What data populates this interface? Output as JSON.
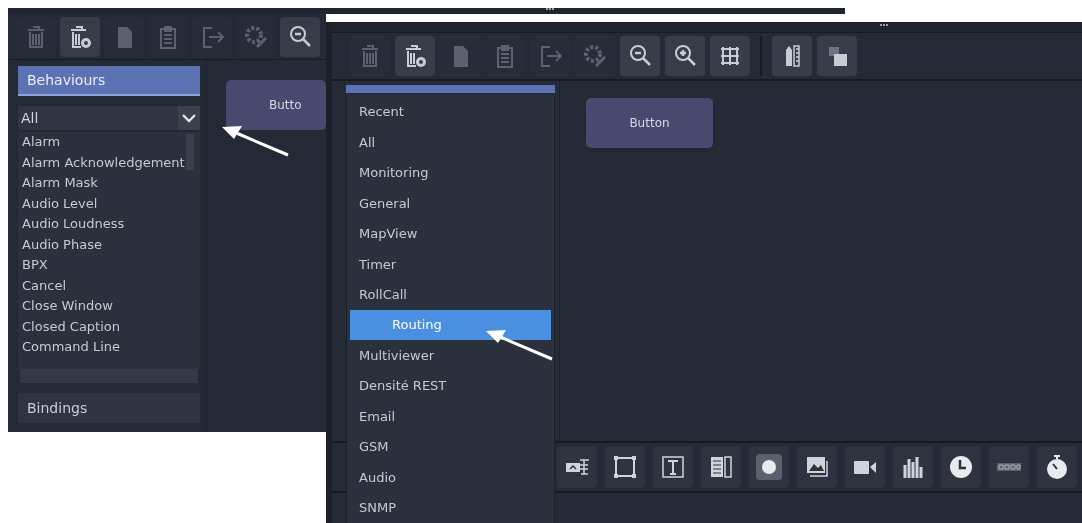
{
  "left_window": {
    "toolbar": [
      {
        "kind": "trash",
        "disabled": true
      },
      {
        "kind": "trash-restore",
        "disabled": false
      },
      {
        "kind": "document",
        "disabled": true
      },
      {
        "kind": "clipboard",
        "disabled": true
      },
      {
        "kind": "export",
        "disabled": true
      },
      {
        "kind": "gear-pencil",
        "disabled": true
      },
      {
        "kind": "zoom-out",
        "disabled": false
      }
    ],
    "panel_header": "Behaviours",
    "filter": {
      "value": "All"
    },
    "items": [
      "Alarm",
      "Alarm Acknowledgement",
      "Alarm Mask",
      "Audio Level",
      "Audio Loudness",
      "Audio Phase",
      "BPX",
      "Cancel",
      "Close Window",
      "Closed Caption",
      "Command Line"
    ],
    "bindings_header": "Bindings",
    "canvas_button": "Butto"
  },
  "right_window": {
    "toolbar": [
      {
        "kind": "trash",
        "disabled": true
      },
      {
        "kind": "trash-restore",
        "disabled": false
      },
      {
        "kind": "document",
        "disabled": true
      },
      {
        "kind": "clipboard",
        "disabled": true
      },
      {
        "kind": "export",
        "disabled": true
      },
      {
        "kind": "gear-pencil",
        "disabled": true
      },
      {
        "kind": "zoom-out",
        "disabled": false
      },
      {
        "kind": "zoom-in",
        "disabled": false
      },
      {
        "kind": "grid",
        "disabled": false
      },
      {
        "kind": "separator"
      },
      {
        "kind": "ruler",
        "disabled": false
      },
      {
        "kind": "layers",
        "disabled": false
      }
    ],
    "menu": [
      {
        "label": "Recent",
        "selected": false
      },
      {
        "label": "All",
        "selected": false
      },
      {
        "label": "Monitoring",
        "selected": false
      },
      {
        "label": "General",
        "selected": false
      },
      {
        "label": "MapView",
        "selected": false
      },
      {
        "label": "Timer",
        "selected": false
      },
      {
        "label": "RollCall",
        "selected": false
      },
      {
        "label": "Routing",
        "selected": true
      },
      {
        "label": "Multiviewer",
        "selected": false
      },
      {
        "label": "Densité REST",
        "selected": false
      },
      {
        "label": "Email",
        "selected": false
      },
      {
        "label": "GSM",
        "selected": false
      },
      {
        "label": "Audio",
        "selected": false
      },
      {
        "label": "SNMP",
        "selected": false
      }
    ],
    "canvas_button": "Button"
  }
}
